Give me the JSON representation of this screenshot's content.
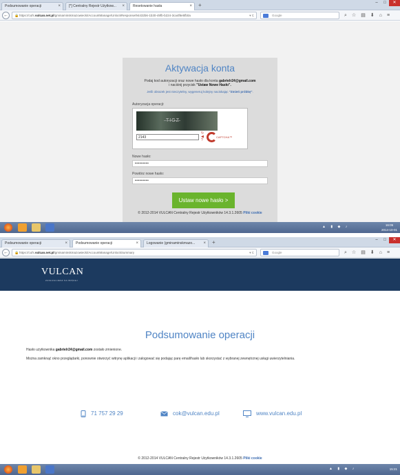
{
  "screen1": {
    "tabs": [
      {
        "label": "Podsumowanie operacji"
      },
      {
        "label": "[*] Centralny Rejestr Użytkow..."
      },
      {
        "label": "Resetowanie hasła"
      }
    ],
    "new_tab": "+",
    "url": {
      "prefix": "https://cufs.",
      "domain": "vulcan.net.pl",
      "path": "/gminaminskmazowiecki/AccountManage/UnlockResponse/94432b6-1b30-49fb-b224-3ca4f8e5fb0a"
    },
    "search_placeholder": "Google",
    "card": {
      "title": "Aktywacja konta",
      "desc_prefix": "Podaj kod autoryzacji oraz nowe hasło dla konta ",
      "desc_email": "gabrielr24@gmail.com",
      "desc_suffix": "i naciśnij przycisk ",
      "desc_button": "\"Ustaw Nowe Hasło\".",
      "help_prefix": "Jeśli obrazek jest nieczytelny, wygeneruj kolejny naciskając ",
      "help_link": "\"Zmień próbkę\"",
      "help_suffix": ".",
      "captcha_label": "Autoryzacja operacji:",
      "captcha_value": "2143",
      "captcha_brand": "CAPTCHA™",
      "new_password_label": "Nowe hasło:",
      "new_password_value": "•••••••••",
      "repeat_password_label": "Powtórz nowe hasło:",
      "repeat_password_value": "•••••••••",
      "submit_label": "Ustaw nowe hasło >"
    },
    "footer": {
      "text": "© 2012-2014 VULCAN Centralny Rejestr Użytkowników 14.3.1.2605",
      "link": "Pliki cookie"
    },
    "taskbar": {
      "time": "16:05",
      "date": "2014-10-01"
    }
  },
  "screen2": {
    "tabs": [
      {
        "label": "Podsumowanie operacji"
      },
      {
        "label": "Podsumowanie operacji"
      },
      {
        "label": "Logowanie (gminaminskmazo..."
      }
    ],
    "new_tab": "+",
    "url": {
      "prefix": "https://cufs.",
      "domain": "vulcan.net.pl",
      "path": "/gminaminskmazowiecki/AccountManage/UnlockSummary"
    },
    "search_placeholder": "Google",
    "brand": {
      "name": "VULCAN",
      "tagline": "ZASŁUGUJESZ NA WIĘCEJ"
    },
    "title": "Podsumowanie operacji",
    "line1_prefix": "Hasło użytkownika ",
    "line1_email": "gabrielr24@gmail.com",
    "line1_suffix": " zostało zmienione.",
    "line2": "Można zamknąć okno przeglądarki, ponownie otworzyć witrynę aplikacji i zalogować się podając parę email/hasło lub skorzystać z wybranej zewnętrznej usługi uwierzytelniania.",
    "contacts": {
      "phone": "71 757 29 29",
      "email": "cok@vulcan.edu.pl",
      "website": "www.vulcan.edu.pl"
    },
    "footer": {
      "text": "© 2012-2014 VULCAN Centralny Rejestr Użytkowników 14.3.1.2605",
      "link": "Pliki cookie"
    },
    "taskbar": {
      "time": "15:21"
    }
  },
  "colors": {
    "accent": "#4f84c4",
    "submit": "#6ab42d",
    "brandbar": "#1c3a5f",
    "close": "#c9302c"
  },
  "icons": [
    "lock-icon",
    "reload-icon",
    "search-icon",
    "star-icon",
    "home-icon",
    "download-icon",
    "menu-icon",
    "phone-icon",
    "mail-icon",
    "monitor-icon"
  ]
}
